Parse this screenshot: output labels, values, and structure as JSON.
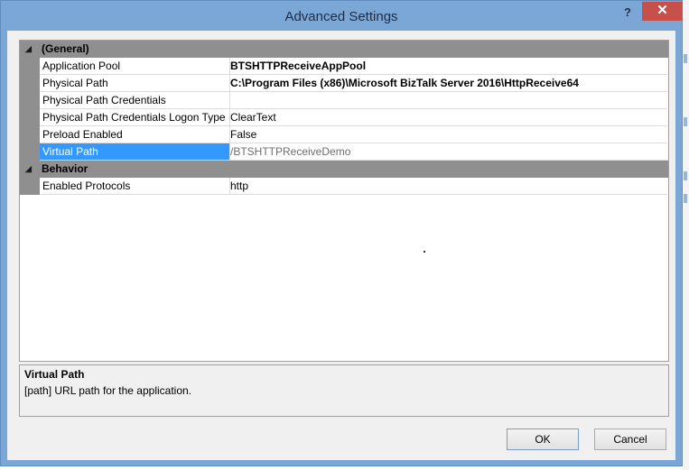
{
  "window": {
    "title": "Advanced Settings",
    "help_label": "?",
    "close_label": "✕"
  },
  "grid": {
    "categories": [
      {
        "label": "(General)",
        "properties": [
          {
            "name": "Application Pool",
            "value": "BTSHTTPReceiveAppPool",
            "bold": true
          },
          {
            "name": "Physical Path",
            "value": "C:\\Program Files (x86)\\Microsoft BizTalk Server 2016\\HttpReceive64",
            "bold": true
          },
          {
            "name": "Physical Path Credentials",
            "value": ""
          },
          {
            "name": "Physical Path Credentials Logon Type",
            "value": "ClearText"
          },
          {
            "name": "Preload Enabled",
            "value": "False"
          },
          {
            "name": "Virtual Path",
            "value": "/BTSHTTPReceiveDemo",
            "selected": true
          }
        ]
      },
      {
        "label": "Behavior",
        "properties": [
          {
            "name": "Enabled Protocols",
            "value": "http"
          }
        ]
      }
    ]
  },
  "description": {
    "title": "Virtual Path",
    "text": "[path] URL path for the application."
  },
  "buttons": {
    "ok": "OK",
    "cancel": "Cancel"
  },
  "colors": {
    "titlebar": "#7aa7d6",
    "close_button": "#c7504b",
    "category_header": "#8f8f8f",
    "selection": "#3399ff"
  },
  "icons": {
    "category_expanded": "collapse-triangle-icon"
  }
}
